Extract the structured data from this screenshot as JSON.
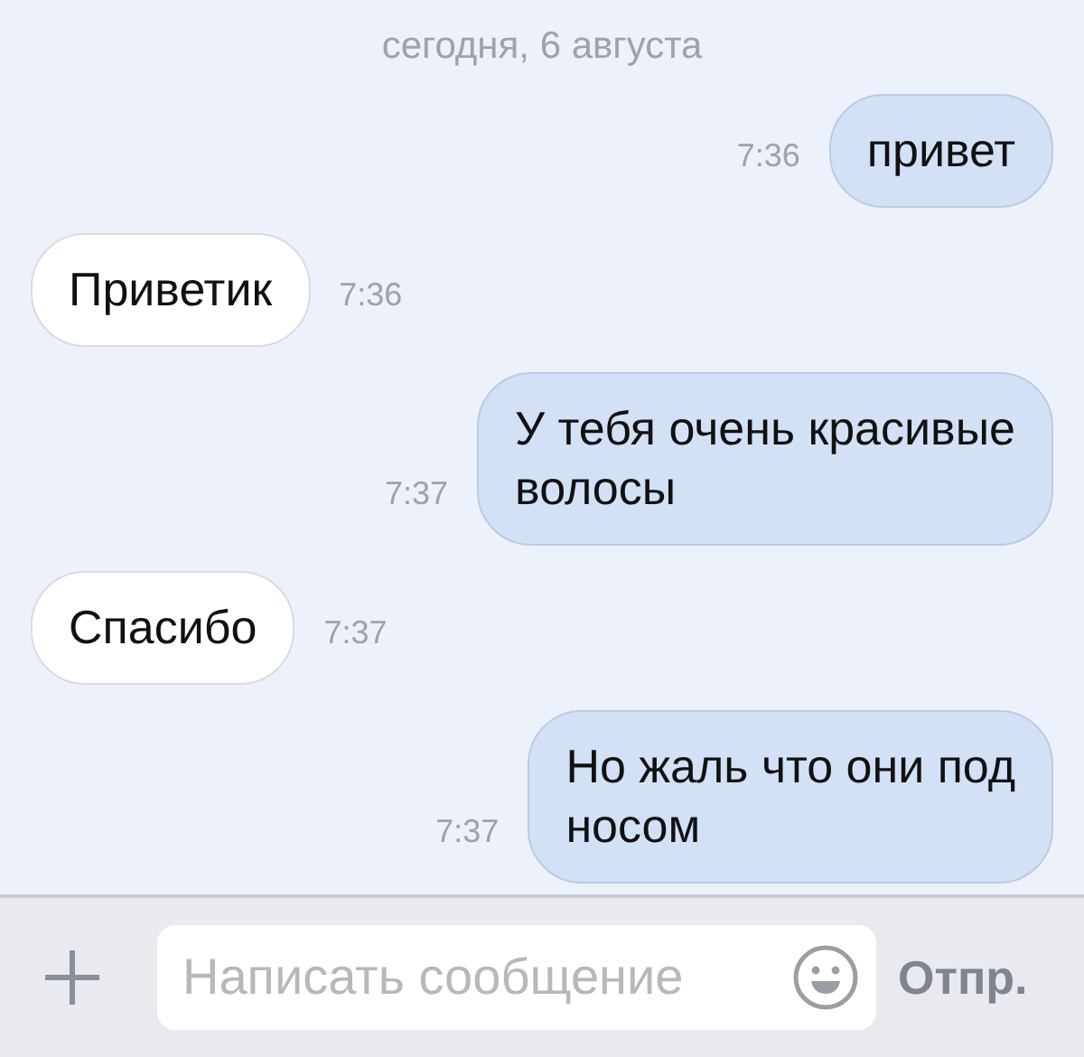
{
  "date_separator": "сегодня, 6 августа",
  "messages": [
    {
      "kind": "out",
      "text": "привет",
      "time": "7:36"
    },
    {
      "kind": "in",
      "text": "Приветик",
      "time": "7:36"
    },
    {
      "kind": "out",
      "text": "У тебя очень красивые\nволосы",
      "time": "7:37"
    },
    {
      "kind": "in",
      "text": "Спасибо",
      "time": "7:37"
    },
    {
      "kind": "out",
      "text": "Но жаль что они под\nносом",
      "time": "7:37"
    }
  ],
  "composer": {
    "placeholder": "Написать сообщение",
    "send_label": "Отпр."
  }
}
